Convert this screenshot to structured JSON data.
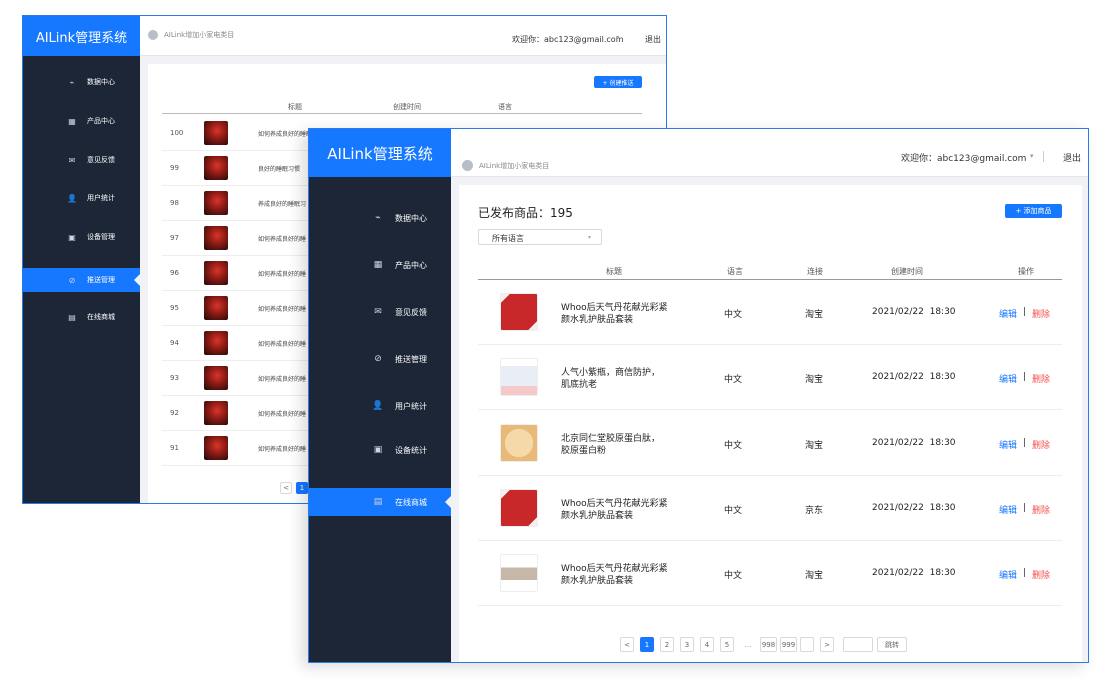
{
  "back": {
    "brand": "AILink管理系统",
    "breadcrumb": "AILink增加小家电类目",
    "user": "欢迎你：abc123@gmail.com",
    "logout": "退出",
    "nav": [
      {
        "label": "数据中心",
        "icon": "chart-icon"
      },
      {
        "label": "产品中心",
        "icon": "grid-icon"
      },
      {
        "label": "意见反馈",
        "icon": "mail-icon"
      },
      {
        "label": "用户统计",
        "icon": "user-icon"
      },
      {
        "label": "设备管理",
        "icon": "image-icon"
      },
      {
        "label": "推送管理",
        "icon": "compass-icon",
        "active": true
      },
      {
        "label": "在线商城",
        "icon": "store-icon"
      }
    ],
    "create_button": "+ 创建推送",
    "columns": [
      "标题",
      "创建时间",
      "语言"
    ],
    "rows": [
      {
        "id": "100",
        "title": "如何养成良好的睡眠习惯"
      },
      {
        "id": "99",
        "title": "良好的睡眠习惯"
      },
      {
        "id": "98",
        "title": "养成良好的睡眠习"
      },
      {
        "id": "97",
        "title": "如何养成良好的睡"
      },
      {
        "id": "96",
        "title": "如何养成良好的睡"
      },
      {
        "id": "95",
        "title": "如何养成良好的睡"
      },
      {
        "id": "94",
        "title": "如何养成良好的睡"
      },
      {
        "id": "93",
        "title": "如何养成良好的睡"
      },
      {
        "id": "92",
        "title": "如何养成良好的睡"
      },
      {
        "id": "91",
        "title": "如何养成良好的睡"
      }
    ],
    "pager_prev": "<",
    "pager_cur": "1"
  },
  "front": {
    "brand": "AILink管理系统",
    "breadcrumb": "AILink增加小家电类目",
    "user": "欢迎你：abc123@gmail.com",
    "user_caret": "▾",
    "logout": "退出",
    "nav": [
      {
        "label": "数据中心",
        "icon": "chart-icon"
      },
      {
        "label": "产品中心",
        "icon": "grid-icon"
      },
      {
        "label": "意见反馈",
        "icon": "mail-icon"
      },
      {
        "label": "推送管理",
        "icon": "compass-icon"
      },
      {
        "label": "用户统计",
        "icon": "user-icon"
      },
      {
        "label": "设备统计",
        "icon": "image-icon"
      },
      {
        "label": "在线商城",
        "icon": "store-icon",
        "active": true
      }
    ],
    "published_label": "已发布商品：195",
    "add_button": "+ 添加商品",
    "lang_select": "所有语言",
    "columns": {
      "title": "标题",
      "lang": "语言",
      "channel": "连接",
      "created": "创建时间",
      "ops": "操作"
    },
    "rows": [
      {
        "title1": "Whoo后天气丹花献光彩紧",
        "title2": "颜水乳护肤品套装",
        "lang": "中文",
        "channel": "淘宝",
        "created": "2021/02/22  18:30",
        "thumb": "red"
      },
      {
        "title1": "人气小紫瓶，商信防护，",
        "title2": "肌底抗老",
        "lang": "中文",
        "channel": "淘宝",
        "created": "2021/02/22  18:30",
        "thumb": "white"
      },
      {
        "title1": "北京同仁堂胶原蛋白肽，",
        "title2": "胶原蛋白粉",
        "lang": "中文",
        "channel": "淘宝",
        "created": "2021/02/22  18:30",
        "thumb": "beige"
      },
      {
        "title1": "Whoo后天气丹花献光彩紧",
        "title2": "颜水乳护肤品套装",
        "lang": "中文",
        "channel": "京东",
        "created": "2021/02/22  18:30",
        "thumb": "red"
      },
      {
        "title1": "Whoo后天气丹花献光彩紧",
        "title2": "颜水乳护肤品套装",
        "lang": "中文",
        "channel": "淘宝",
        "created": "2021/02/22  18:30",
        "thumb": "light"
      }
    ],
    "edit": "编辑",
    "sep": "|",
    "delete": "删除",
    "pager": [
      "<",
      "1",
      "2",
      "3",
      "4",
      "5",
      "...",
      "998",
      "999",
      "",
      ">"
    ],
    "jump_button": "跳转",
    "colors": {
      "accent": "#1677ff",
      "sidebar": "#1c2636",
      "delete": "#f5504b"
    }
  }
}
